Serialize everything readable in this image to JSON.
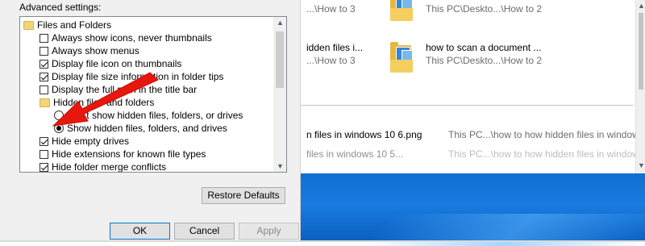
{
  "explorer": {
    "items": [
      {
        "name": "",
        "path": "...\\How to 3"
      },
      {
        "name": "",
        "path": "This PC\\Deskto...\\How to 2"
      },
      {
        "name": "idden files i...",
        "path": "...\\How to 3"
      },
      {
        "name": "how to scan a document ...",
        "path": "This PC\\Deskto...\\How to 2"
      }
    ],
    "list_rows": [
      {
        "name": "n files in windows 10 6.png",
        "path": "This PC...\\how to how hidden files in windows"
      },
      {
        "name": "files in windows 10 5...",
        "path": "This PC...\\how to how hidden files in windows"
      }
    ]
  },
  "dialog": {
    "advanced_label": "Advanced settings:",
    "tree": [
      {
        "kind": "folder",
        "label": "Files and Folders"
      },
      {
        "kind": "checkbox",
        "checked": false,
        "label": "Always show icons, never thumbnails"
      },
      {
        "kind": "checkbox",
        "checked": false,
        "label": "Always show menus"
      },
      {
        "kind": "checkbox",
        "checked": true,
        "label": "Display file icon on thumbnails"
      },
      {
        "kind": "checkbox",
        "checked": true,
        "label": "Display file size information in folder tips"
      },
      {
        "kind": "checkbox",
        "checked": false,
        "label": "Display the full path in the title bar"
      },
      {
        "kind": "folder",
        "label": "Hidden files and folders"
      },
      {
        "kind": "radio",
        "checked": false,
        "label": "Don't show hidden files, folders, or drives"
      },
      {
        "kind": "radio",
        "checked": true,
        "label": "Show hidden files, folders, and drives"
      },
      {
        "kind": "checkbox",
        "checked": true,
        "label": "Hide empty drives"
      },
      {
        "kind": "checkbox",
        "checked": false,
        "label": "Hide extensions for known file types"
      },
      {
        "kind": "checkbox",
        "checked": true,
        "label": "Hide folder merge conflicts"
      }
    ],
    "restore_defaults": "Restore Defaults",
    "ok": "OK",
    "cancel": "Cancel",
    "apply": "Apply"
  },
  "colors": {
    "arrow": "#e8170d",
    "desktop_blue": "#1a7be0",
    "folder_yellow": "#e7b83c"
  }
}
